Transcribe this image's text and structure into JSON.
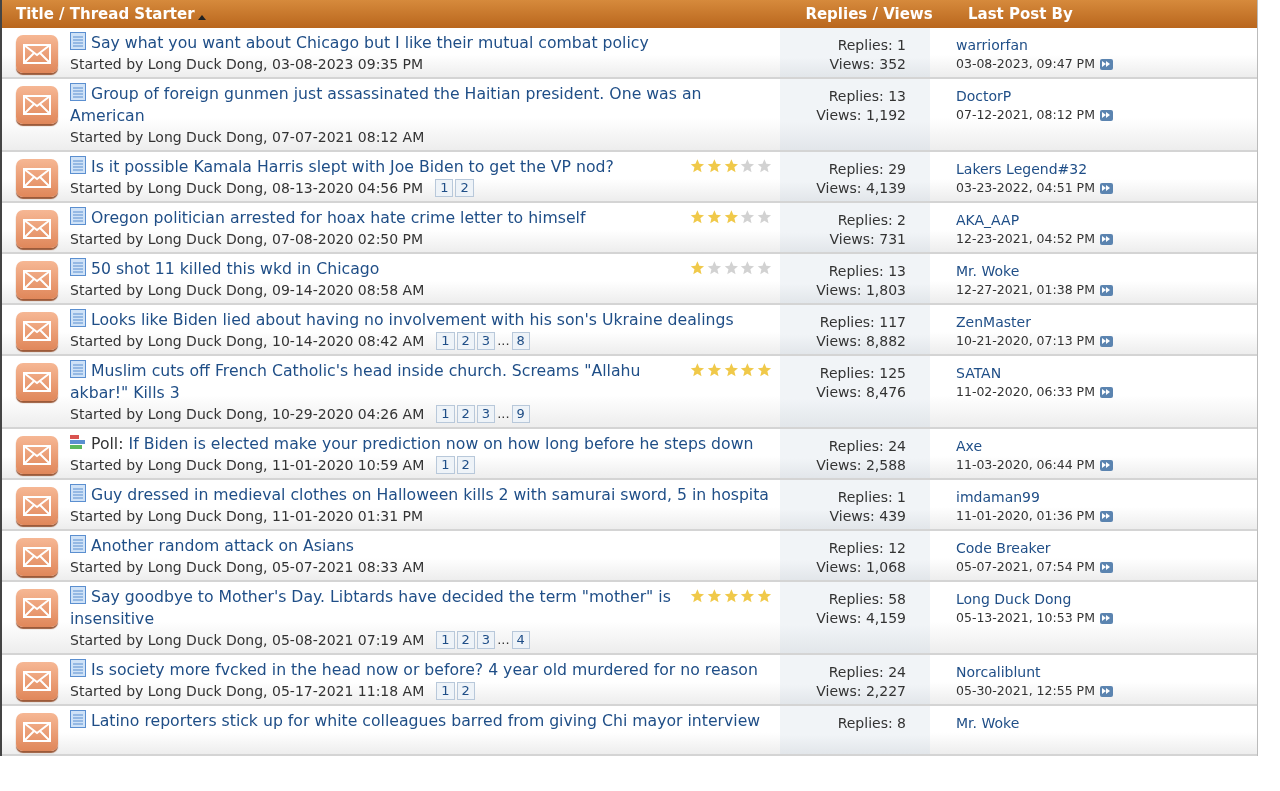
{
  "header": {
    "title_column": "Title / Thread Starter",
    "sort_ascending": true,
    "stats_column": "Replies / Views",
    "last_column": "Last Post By"
  },
  "threads": [
    {
      "kind": "doc",
      "title": "Say what you want about Chicago but I like their mutual combat policy",
      "starter": "Started by Long Duck Dong, 03-08-2023 09:35 PM",
      "replies": "Replies: 1",
      "views": "Views: 352",
      "last_by": "warriorfan",
      "last_date": "03-08-2023, 09:47 PM"
    },
    {
      "kind": "doc",
      "title": "Group of foreign gunmen just assassinated the Haitian president. One was an American",
      "starter": "Started by Long Duck Dong, 07-07-2021 08:12 AM",
      "replies": "Replies: 13",
      "views": "Views: 1,192",
      "last_by": "DoctorP",
      "last_date": "07-12-2021, 08:12 PM"
    },
    {
      "kind": "doc",
      "title": "Is it possible Kamala Harris slept with Joe Biden to get the VP nod?",
      "stars": 3,
      "starter": "Started by Long Duck Dong, 08-13-2020 04:56 PM",
      "pages": [
        {
          "kind": "page",
          "label": "1"
        },
        {
          "kind": "page",
          "label": "2"
        }
      ],
      "replies": "Replies: 29",
      "views": "Views: 4,139",
      "last_by": "Lakers Legend#32",
      "last_date": "03-23-2022, 04:51 PM"
    },
    {
      "kind": "doc",
      "title": "Oregon politician arrested for hoax hate crime letter to himself",
      "stars": 3,
      "starter": "Started by Long Duck Dong, 07-08-2020 02:50 PM",
      "replies": "Replies: 2",
      "views": "Views: 731",
      "last_by": "AKA_AAP",
      "last_date": "12-23-2021, 04:52 PM"
    },
    {
      "kind": "doc",
      "title": "50 shot 11 killed this wkd in Chicago",
      "stars": 1,
      "starter": "Started by Long Duck Dong, 09-14-2020 08:58 AM",
      "replies": "Replies: 13",
      "views": "Views: 1,803",
      "last_by": "Mr. Woke",
      "last_date": "12-27-2021, 01:38 PM"
    },
    {
      "kind": "doc",
      "title": "Looks like Biden lied about having no involvement with his son's Ukraine dealings",
      "starter": "Started by Long Duck Dong, 10-14-2020 08:42 AM",
      "pages": [
        {
          "kind": "page",
          "label": "1"
        },
        {
          "kind": "page",
          "label": "2"
        },
        {
          "kind": "page",
          "label": "3"
        },
        {
          "kind": "gap",
          "label": "..."
        },
        {
          "kind": "page",
          "label": "8"
        }
      ],
      "replies": "Replies: 117",
      "views": "Views: 8,882",
      "last_by": "ZenMaster",
      "last_date": "10-21-2020, 07:13 PM"
    },
    {
      "kind": "doc",
      "title": "Muslim cuts off French Catholic's head inside church. Screams \"Allahu akbar!\" Kills 3",
      "stars": 5,
      "starter": "Started by Long Duck Dong, 10-29-2020 04:26 AM",
      "pages": [
        {
          "kind": "page",
          "label": "1"
        },
        {
          "kind": "page",
          "label": "2"
        },
        {
          "kind": "page",
          "label": "3"
        },
        {
          "kind": "gap",
          "label": "..."
        },
        {
          "kind": "page",
          "label": "9"
        }
      ],
      "replies": "Replies: 125",
      "views": "Views: 8,476",
      "last_by": "SATAN",
      "last_date": "11-02-2020, 06:33 PM"
    },
    {
      "kind": "poll",
      "prefix": "Poll:",
      "title": "If Biden is elected make your prediction now on how long before he steps down",
      "starter": "Started by Long Duck Dong, 11-01-2020 10:59 AM",
      "pages": [
        {
          "kind": "page",
          "label": "1"
        },
        {
          "kind": "page",
          "label": "2"
        }
      ],
      "replies": "Replies: 24",
      "views": "Views: 2,588",
      "last_by": "Axe",
      "last_date": "11-03-2020, 06:44 PM"
    },
    {
      "kind": "doc",
      "title": "Guy dressed in medieval clothes on Halloween kills 2 with samurai sword, 5 in hospita",
      "starter": "Started by Long Duck Dong, 11-01-2020 01:31 PM",
      "replies": "Replies: 1",
      "views": "Views: 439",
      "last_by": "imdaman99",
      "last_date": "11-01-2020, 01:36 PM"
    },
    {
      "kind": "doc",
      "title": "Another random attack on Asians",
      "starter": "Started by Long Duck Dong, 05-07-2021 08:33 AM",
      "replies": "Replies: 12",
      "views": "Views: 1,068",
      "last_by": "Code Breaker",
      "last_date": "05-07-2021, 07:54 PM"
    },
    {
      "kind": "doc",
      "title": "Say goodbye to Mother's Day. Libtards have decided the term \"mother\" is insensitive",
      "stars": 5,
      "starter": "Started by Long Duck Dong, 05-08-2021 07:19 AM",
      "pages": [
        {
          "kind": "page",
          "label": "1"
        },
        {
          "kind": "page",
          "label": "2"
        },
        {
          "kind": "page",
          "label": "3"
        },
        {
          "kind": "gap",
          "label": "..."
        },
        {
          "kind": "page",
          "label": "4"
        }
      ],
      "replies": "Replies: 58",
      "views": "Views: 4,159",
      "last_by": "Long Duck Dong",
      "last_date": "05-13-2021, 10:53 PM"
    },
    {
      "kind": "doc",
      "title": "Is society more fvcked in the head now or before? 4 year old murdered for no reason",
      "starter": "Started by Long Duck Dong, 05-17-2021 11:18 AM",
      "pages": [
        {
          "kind": "page",
          "label": "1"
        },
        {
          "kind": "page",
          "label": "2"
        }
      ],
      "replies": "Replies: 24",
      "views": "Views: 2,227",
      "last_by": "Norcaliblunt",
      "last_date": "05-30-2021, 12:55 PM"
    },
    {
      "kind": "doc",
      "title": "Latino reporters stick up for white colleagues barred from giving Chi mayor interview",
      "replies": "Replies: 8",
      "last_by": "Mr. Woke"
    }
  ]
}
